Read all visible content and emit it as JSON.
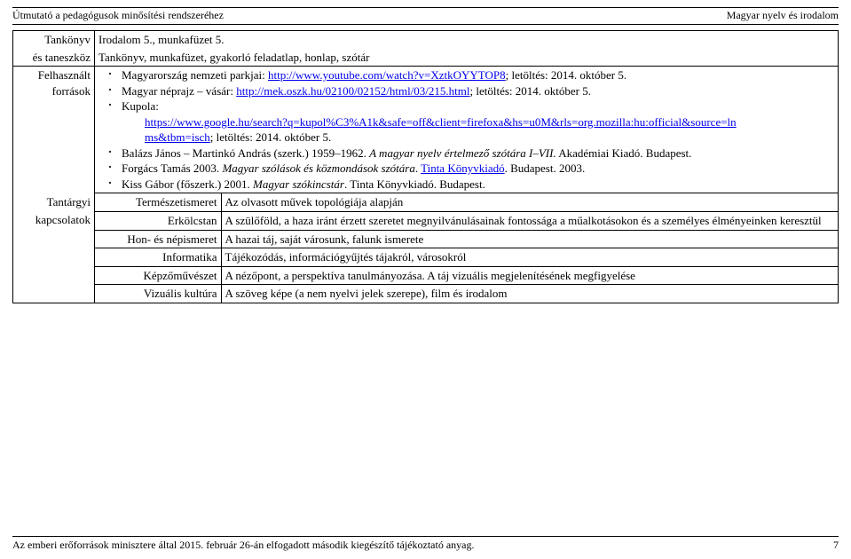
{
  "header": {
    "left": "Útmutató a pedagógusok minősítési rendszeréhez",
    "right": "Magyar nyelv és irodalom"
  },
  "rows": {
    "tankonyv_label_1": "Tankönyv",
    "tankonyv_label_2": "és taneszköz",
    "tankonyv_line1": "Irodalom 5., munkafüzet 5.",
    "tankonyv_line2": "Tankönyv, munkafüzet, gyakorló feladatlap, honlap, szótár",
    "felhasznalt_label_1": "Felhasznált",
    "felhasznalt_label_2": "források",
    "src1_pre": "Magyarország nemzeti parkjai: ",
    "src1_link": "http://www.youtube.com/watch?v=XztkOYYTOP8",
    "src1_post": "; letöltés: 2014. október 5.",
    "src2_pre": "Magyar néprajz – vásár: ",
    "src2_link": "http://mek.oszk.hu/02100/02152/html/03/215.html",
    "src2_post": "; letöltés: 2014. október 5.",
    "src3_label": "Kupola:",
    "src3_linkA": "https://www.google.hu/search?q=kupol%C3%A1k&safe=off&client=firefoxa&hs=u0M&rls=org.mozilla:hu:official&source=ln",
    "src3_linkB": "ms&tbm=isch",
    "src3_post": "; letöltés: 2014. október 5.",
    "src4_pre": "Balázs János – Martinkó András (szerk.) 1959–1962. ",
    "src4_ital": "A magyar nyelv értelmező szótára I–VII.",
    "src4_post": " Akadémiai Kiadó. Budapest.",
    "src5_pre": "Forgács Tamás 2003. ",
    "src5_ital": "Magyar szólások és közmondások szótára",
    "src5_mid": ". ",
    "src5_link": "Tinta Könyvkiadó",
    "src5_post": ". Budapest. 2003.",
    "src6_pre": "Kiss Gábor (főszerk.) 2001. ",
    "src6_ital": "Magyar szókincstár",
    "src6_post": ". Tinta Könyvkiadó. Budapest.",
    "tantargyi_label_1": "Tantárgyi",
    "tantargyi_label_2": "kapcsolatok"
  },
  "inner": [
    {
      "mid": "Természetismeret",
      "right": "Az olvasott művek topológiája alapján"
    },
    {
      "mid": "Erkölcstan",
      "right": "A szülőföld, a haza iránt érzett szeretet megnyilvánulásainak fontossága a műalkotásokon és a személyes élményeinken keresztül"
    },
    {
      "mid": "Hon- és népismeret",
      "right": "A hazai táj, saját városunk, falunk ismerete"
    },
    {
      "mid": "Informatika",
      "right": "Tájékozódás, információgyűjtés tájakról, városokról"
    },
    {
      "mid": "Képzőművészet",
      "right": "A nézőpont, a perspektíva tanulmányozása. A táj vizuális megjelenítésének megfigyelése"
    },
    {
      "mid": "Vizuális kultúra",
      "right": "A szöveg képe (a nem nyelvi jelek szerepe), film és irodalom"
    }
  ],
  "footer": {
    "left": "Az emberi erőforrások minisztere által 2015. február 26-án elfogadott második kiegészítő tájékoztató anyag.",
    "right": "7"
  }
}
